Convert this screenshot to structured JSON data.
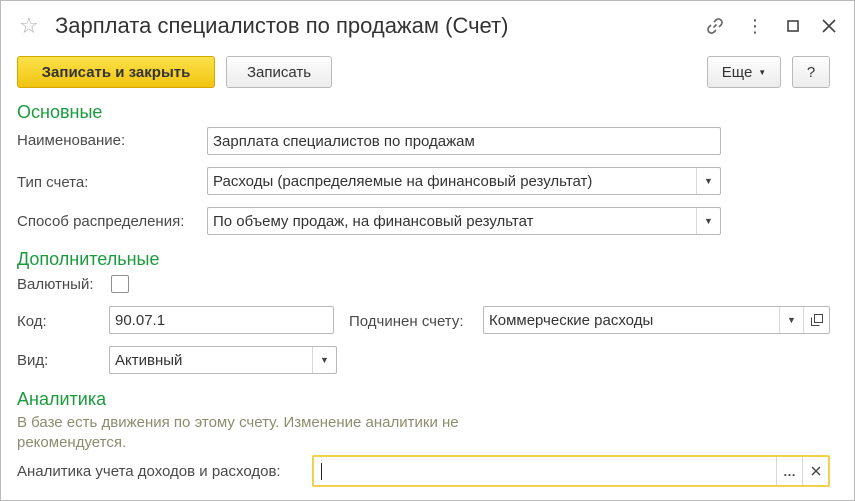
{
  "window": {
    "title": "Зарплата специалистов по продажам (Счет)"
  },
  "toolbar": {
    "save_close_label": "Записать и закрыть",
    "save_label": "Записать",
    "more_label": "Еще",
    "help_label": "?"
  },
  "sections": {
    "main": "Основные",
    "additional": "Дополнительные",
    "analytics": "Аналитика"
  },
  "fields": {
    "name": {
      "label": "Наименование:",
      "value": "Зарплата специалистов по продажам"
    },
    "account_type": {
      "label": "Тип счета:",
      "value": "Расходы (распределяемые на финансовый результат)"
    },
    "distribution": {
      "label": "Способ распределения:",
      "value": "По объему продаж, на финансовый результат"
    },
    "currency": {
      "label": "Валютный:",
      "checked": false
    },
    "code": {
      "label": "Код:",
      "value": "90.07.1"
    },
    "parent": {
      "label": "Подчинен счету:",
      "value": "Коммерческие расходы"
    },
    "kind": {
      "label": "Вид:",
      "value": "Активный"
    },
    "analytics_income": {
      "label": "Аналитика учета доходов и расходов:",
      "value": ""
    }
  },
  "analytics_note": "В базе есть движения по этому счету. Изменение аналитики не рекомендуется."
}
